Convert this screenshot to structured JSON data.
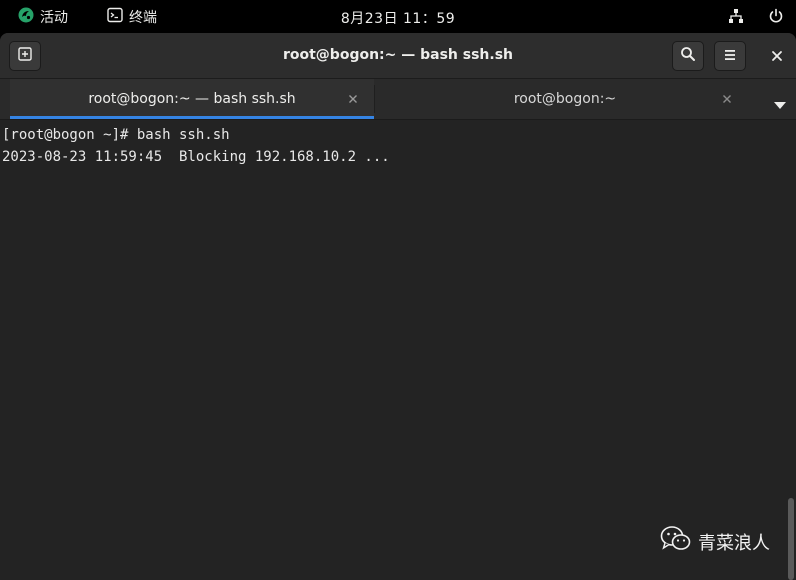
{
  "topbar": {
    "activities_label": "活动",
    "app_label": "终端",
    "clock": "8月23日  11：59",
    "icons": [
      "network-icon",
      "power-icon"
    ]
  },
  "window": {
    "title": "root@bogon:~ — bash ssh.sh",
    "buttons": [
      "new-tab-icon",
      "search-icon",
      "hamburger-menu-icon",
      "close-icon"
    ]
  },
  "tabs": [
    {
      "label": "root@bogon:~ — bash ssh.sh",
      "active": true
    },
    {
      "label": "root@bogon:~",
      "active": false
    }
  ],
  "terminal": {
    "lines": [
      "[root@bogon ~]# bash ssh.sh",
      "2023-08-23 11:59:45  Blocking 192.168.10.2 ..."
    ]
  },
  "watermark": {
    "text": "青菜浪人"
  },
  "colors": {
    "accent": "#3584e4",
    "background": "#232323",
    "activities_logo": "#26a269"
  }
}
